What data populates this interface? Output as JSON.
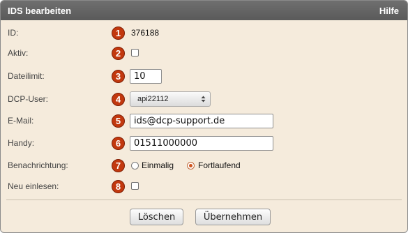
{
  "dialog": {
    "title": "IDS bearbeiten",
    "help_label": "Hilfe"
  },
  "rows": [
    {
      "num": "1",
      "label": "ID:",
      "value": "376188"
    },
    {
      "num": "2",
      "label": "Aktiv:",
      "checked": false
    },
    {
      "num": "3",
      "label": "Dateilimit:",
      "value": "10"
    },
    {
      "num": "4",
      "label": "DCP-User:",
      "value": "api22112"
    },
    {
      "num": "5",
      "label": "E-Mail:",
      "value": "ids@dcp-support.de"
    },
    {
      "num": "6",
      "label": "Handy:",
      "value": "01511000000"
    },
    {
      "num": "7",
      "label": "Benachrichtung:",
      "options": [
        {
          "label": "Einmalig",
          "selected": false
        },
        {
          "label": "Fortlaufend",
          "selected": true
        }
      ]
    },
    {
      "num": "8",
      "label": "Neu einlesen:",
      "checked": false
    }
  ],
  "buttons": {
    "delete_label": "Löschen",
    "apply_label": "Übernehmen"
  },
  "colors": {
    "badge": "#c2380e",
    "titlebar": "#666666",
    "panel_bg": "#f5ebdc"
  }
}
